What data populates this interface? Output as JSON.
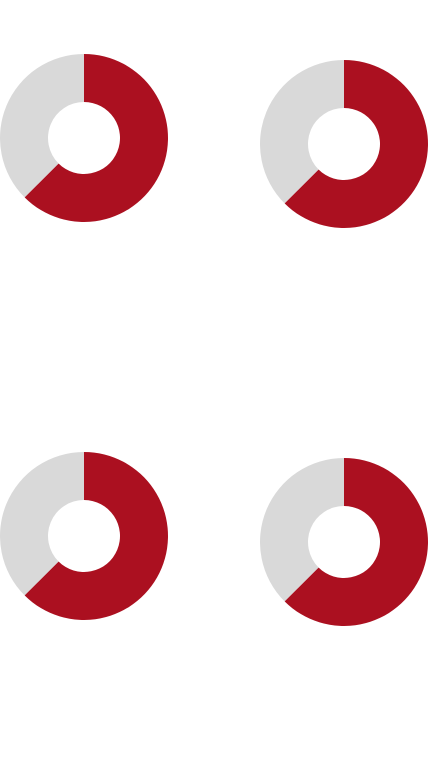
{
  "colors": {
    "primary": "#ab1020",
    "secondary": "#d9d9d9",
    "background": "#ffffff"
  },
  "chart_data": [
    {
      "type": "pie",
      "donut": true,
      "start": "top",
      "direction": "clockwise",
      "slices": [
        {
          "value": 62.5,
          "color": "#ab1020"
        },
        {
          "value": 37.5,
          "color": "#d9d9d9"
        }
      ]
    },
    {
      "type": "pie",
      "donut": true,
      "start": "top",
      "direction": "clockwise",
      "slices": [
        {
          "value": 62.5,
          "color": "#ab1020"
        },
        {
          "value": 37.5,
          "color": "#d9d9d9"
        }
      ]
    },
    {
      "type": "pie",
      "donut": true,
      "start": "top",
      "direction": "clockwise",
      "slices": [
        {
          "value": 62.5,
          "color": "#ab1020"
        },
        {
          "value": 37.5,
          "color": "#d9d9d9"
        }
      ]
    },
    {
      "type": "pie",
      "donut": true,
      "start": "top",
      "direction": "clockwise",
      "slices": [
        {
          "value": 62.5,
          "color": "#ab1020"
        },
        {
          "value": 37.5,
          "color": "#d9d9d9"
        }
      ]
    }
  ]
}
